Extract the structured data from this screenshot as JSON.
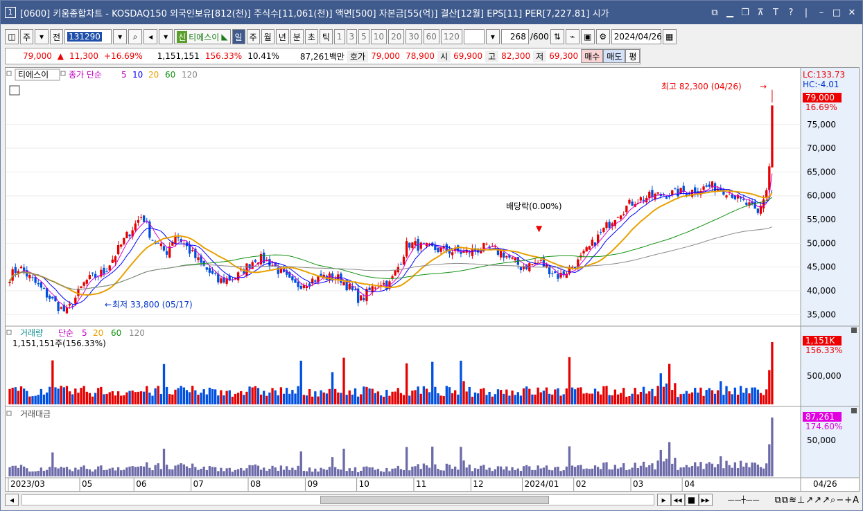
{
  "title": {
    "number": "1",
    "text": "[0600] 키움종합차트 - KOSDAQ150 외국인보유[812(천)] 주식수[11,061(천)] 액면[500] 자본금[55(억)] 결산[12월] EPS[11] PER[7,227.81] 시가",
    "icons": [
      "tile-icon",
      "minimize-icon",
      "restore-icon",
      "pin-icon",
      "font-icon",
      "help-icon",
      "min-icon",
      "max-icon",
      "close-icon"
    ]
  },
  "toolbar": {
    "period_label": "주",
    "prev_label": "전",
    "code": "131290",
    "stock_tag": "신",
    "stock_name": "티에스이",
    "periods": [
      "일",
      "주",
      "월",
      "년",
      "분",
      "초",
      "틱"
    ],
    "minutes": [
      "1",
      "3",
      "5",
      "10",
      "20",
      "30",
      "60",
      "120"
    ],
    "count": "268",
    "count_total": "/600",
    "date": "2024/04/26"
  },
  "quote": {
    "price": "79,000",
    "change": "11,300",
    "change_pct": "+16.69%",
    "volume": "1,151,151",
    "vol_ratio": "156.33%",
    "turnover": "10.41%",
    "amount": "87,261백만",
    "ask_label": "호가",
    "ask": "79,000",
    "bid": "78,900",
    "open_label": "시",
    "open": "69,900",
    "high_label": "고",
    "high": "82,300",
    "low_label": "저",
    "low": "69,300",
    "buy_label": "매수",
    "sell_label": "매도",
    "avg_label": "평"
  },
  "price_panel": {
    "stock": "티에스이",
    "ma_label": "종가 단순",
    "ma": [
      "5",
      "10",
      "20",
      "60",
      "120"
    ],
    "lc": "LC:133.73",
    "hc": "HC:-4.01",
    "last": "79,000",
    "last_pct": "16.69%",
    "ticks": [
      "75,000",
      "70,000",
      "65,000",
      "60,000",
      "55,000",
      "50,000",
      "45,000",
      "40,000",
      "35,000"
    ],
    "max_label": "최고 82,300 (04/26)",
    "min_label": "최저 33,800 (05/17)",
    "dividend": "배당락(0.00%)"
  },
  "volume_panel": {
    "label": "거래량",
    "ma_label": "단순",
    "ma": [
      "5",
      "20",
      "60",
      "120"
    ],
    "value": "1,151,151주(156.33%)",
    "last": "1,151K",
    "last_pct": "156.33%",
    "tick": "500,000"
  },
  "amount_panel": {
    "label": "거래대금",
    "last": "87,261",
    "last_pct": "174.60%",
    "tick": "50,000"
  },
  "xaxis": {
    "labels": [
      "2023/03",
      "05",
      "06",
      "07",
      "08",
      "09",
      "10",
      "11",
      "12",
      "2024/01",
      "02",
      "03",
      "04"
    ],
    "last": "04/26"
  },
  "colors": {
    "up": "#e60000",
    "down": "#0050e0",
    "ma5": "#d000d0",
    "ma10": "#0000ff",
    "ma20": "#e8a000",
    "ma60": "#109010",
    "ma120": "#888888",
    "title": "#3f5a8c"
  },
  "chart_data": {
    "type": "candlestick",
    "ylim": [
      33000,
      84000
    ],
    "anchors": [
      [
        0,
        43000
      ],
      [
        10,
        45000
      ],
      [
        35,
        40000
      ],
      [
        55,
        36000
      ],
      [
        60,
        35500
      ],
      [
        80,
        42000
      ],
      [
        100,
        44000
      ],
      [
        125,
        52000
      ],
      [
        140,
        56000
      ],
      [
        150,
        51000
      ],
      [
        165,
        48000
      ],
      [
        175,
        52000
      ],
      [
        200,
        46000
      ],
      [
        220,
        42000
      ],
      [
        240,
        43000
      ],
      [
        260,
        47000
      ],
      [
        275,
        46000
      ],
      [
        300,
        41000
      ],
      [
        330,
        43000
      ],
      [
        350,
        42500
      ],
      [
        370,
        38000
      ],
      [
        390,
        42000
      ],
      [
        400,
        41000
      ],
      [
        410,
        45000
      ],
      [
        420,
        50000
      ],
      [
        440,
        49000
      ],
      [
        460,
        48500
      ],
      [
        480,
        48000
      ],
      [
        500,
        49000
      ],
      [
        520,
        48000
      ],
      [
        540,
        45000
      ],
      [
        560,
        46000
      ],
      [
        580,
        43000
      ],
      [
        600,
        46000
      ],
      [
        620,
        51000
      ],
      [
        640,
        56000
      ],
      [
        660,
        59000
      ],
      [
        680,
        60000
      ],
      [
        700,
        60500
      ],
      [
        720,
        61000
      ],
      [
        740,
        62000
      ],
      [
        760,
        61000
      ],
      [
        770,
        59000
      ],
      [
        780,
        58000
      ],
      [
        790,
        56000
      ],
      [
        800,
        62000
      ],
      [
        808,
        79000
      ]
    ]
  }
}
